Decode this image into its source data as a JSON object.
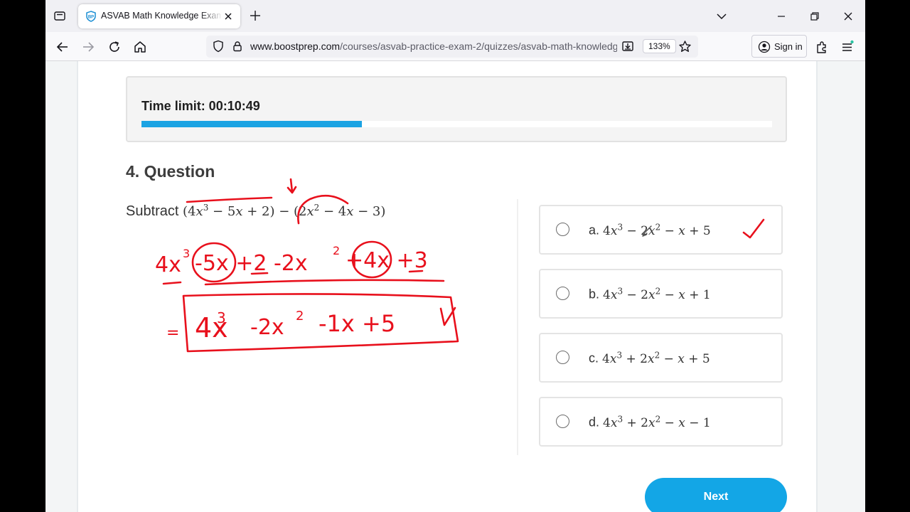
{
  "browser": {
    "tab_title": "ASVAB Math Knowledge Exam 2",
    "url_host": "www.boostprep.com",
    "url_path": "/courses/asvab-practice-exam-2/quizzes/asvab-math-knowledge",
    "zoom": "133%",
    "sign_in": "Sign in"
  },
  "quiz": {
    "time_limit_label": "Time limit: 00:10:49",
    "progress_fraction": 0.35,
    "question_title": "4. Question",
    "question_prefix": "Subtract",
    "options": [
      {
        "letter": "a."
      },
      {
        "letter": "b."
      },
      {
        "letter": "c."
      },
      {
        "letter": "d."
      }
    ],
    "next_label": "Next"
  },
  "handwriting": {
    "line1": "4x",
    "line1_exp": "3",
    "line1_b": "-5x +2  -2x",
    "line1_b_exp": "2",
    "line1_c": "+4x +3",
    "line2_eq": "=",
    "line2": "4x",
    "line2_exp": "3",
    "line2_b": "-2x",
    "line2_b_exp": "2",
    "line2_c": "-1x  +5",
    "ink_color": "#e8101c"
  },
  "colors": {
    "accent": "#13a6e6",
    "progress": "#1ba3e3"
  }
}
